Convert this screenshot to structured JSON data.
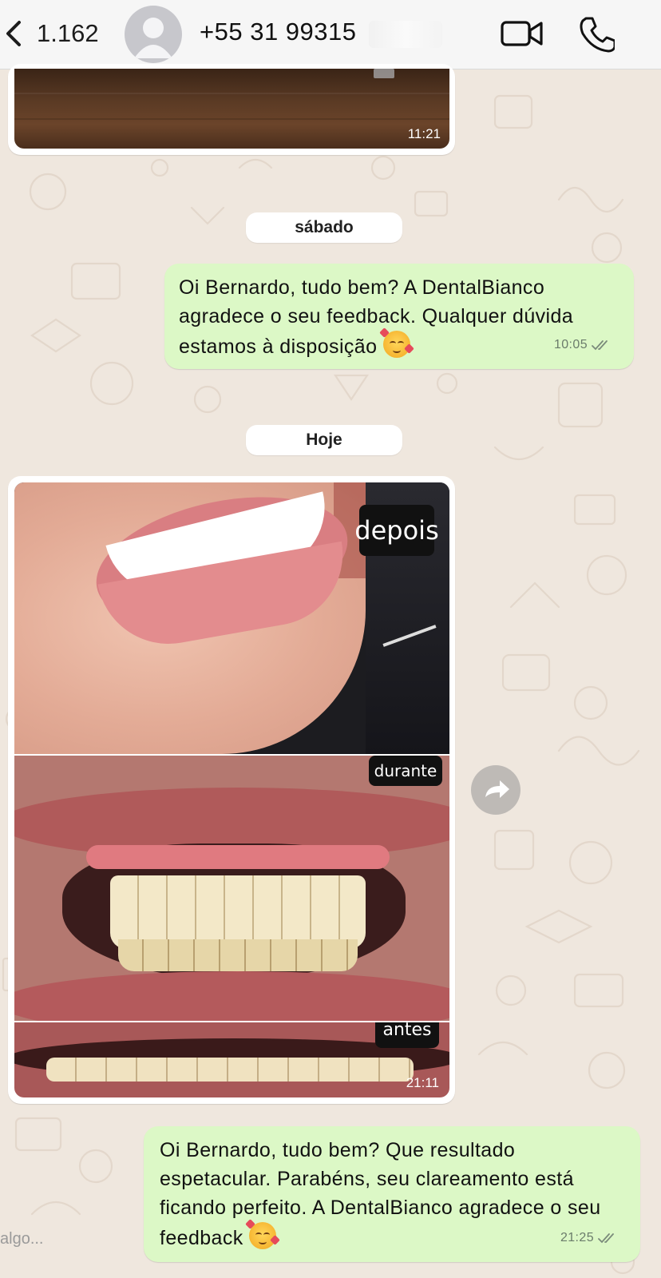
{
  "header": {
    "back_count": "1.162",
    "contact_name": "+55 31 99315"
  },
  "icons": {
    "back": "chevron-left-icon",
    "avatar": "person-icon",
    "video": "video-camera-icon",
    "call": "phone-icon",
    "forward": "forward-arrow-icon",
    "read_receipt": "double-check-icon"
  },
  "colors": {
    "outgoing_bubble": "#dcf8c6",
    "incoming_bubble": "#ffffff",
    "wallpaper": "#efe7de",
    "header": "#f6f6f6"
  },
  "messages": {
    "top_image": {
      "time": "11:21"
    },
    "date_1": "sábado",
    "msg_1": {
      "text": "Oi Bernardo, tudo bem? A DentalBianco agradece o seu feedback. Qualquer dúvida estamos à disposição",
      "emoji": "smiling-face-with-hearts",
      "time": "10:05"
    },
    "date_2": "Hoje",
    "photo": {
      "label_top": "depois",
      "label_mid": "durante",
      "label_bottom": "antes",
      "time": "21:11"
    },
    "msg_2": {
      "text": "Oi Bernardo, tudo bem? Que resultado espetacular. Parabéns, seu clareamento está ficando perfeito. A DentalBianco agradece o seu feedback",
      "emoji": "smiling-face-with-hearts",
      "time": "21:25"
    }
  },
  "composer": {
    "placeholder_partial": "algo..."
  }
}
